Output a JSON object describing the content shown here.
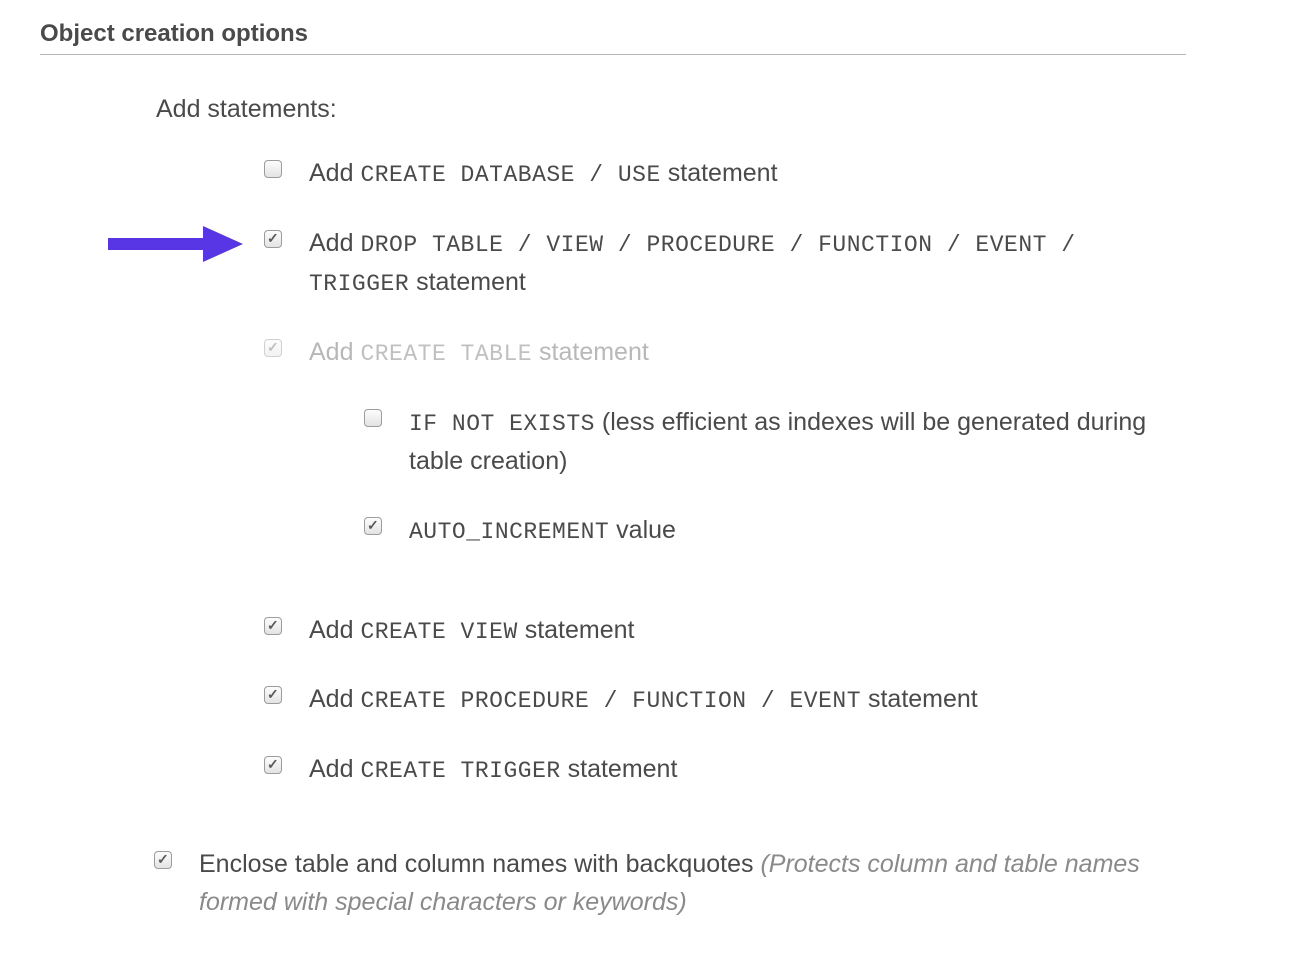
{
  "section": {
    "title": "Object creation options"
  },
  "groupLabel": "Add statements:",
  "options": {
    "createDatabase": {
      "checked": false,
      "pre": "Add ",
      "kw": "CREATE DATABASE / USE",
      "post": " statement"
    },
    "dropTable": {
      "checked": true,
      "pre": "Add ",
      "kw": "DROP TABLE / VIEW / PROCEDURE / FUNCTION / EVENT / TRIGGER",
      "post": " statement"
    },
    "createTable": {
      "checked": true,
      "disabled": true,
      "pre": "Add ",
      "kw": "CREATE TABLE",
      "post": " statement"
    },
    "ifNotExists": {
      "checked": false,
      "kw": "IF NOT EXISTS",
      "post": " (less efficient as indexes will be generated during table creation)"
    },
    "autoIncrement": {
      "checked": true,
      "kw": "AUTO_INCREMENT",
      "post": " value"
    },
    "createView": {
      "checked": true,
      "pre": "Add ",
      "kw": "CREATE VIEW",
      "post": " statement"
    },
    "createProcedure": {
      "checked": true,
      "pre": "Add ",
      "kw": "CREATE PROCEDURE / FUNCTION / EVENT",
      "post": " statement"
    },
    "createTrigger": {
      "checked": true,
      "pre": "Add ",
      "kw": "CREATE TRIGGER",
      "post": " statement"
    },
    "backquotes": {
      "checked": true,
      "label": "Enclose table and column names with backquotes ",
      "hint": "(Protects column and table names formed with special characters or keywords)"
    }
  },
  "annotation": {
    "arrowColor": "#5836e5"
  }
}
